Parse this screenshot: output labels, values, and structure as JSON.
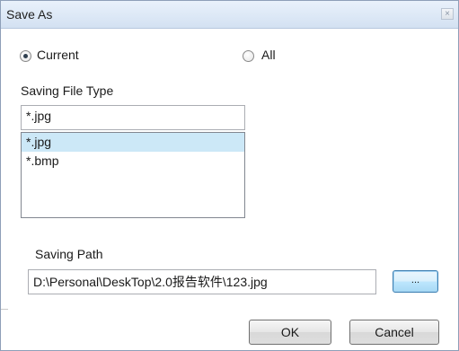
{
  "window": {
    "title": "Save As",
    "close_glyph": "×"
  },
  "scope": {
    "current_label": "Current",
    "all_label": "All",
    "selected": "Current"
  },
  "file_type": {
    "label": "Saving File Type",
    "value": "*.jpg",
    "options": [
      "*.jpg",
      "*.bmp"
    ],
    "selected_option": "*.jpg"
  },
  "path": {
    "label": "Saving Path",
    "value": "D:\\Personal\\DeskTop\\2.0报告软件\\123.jpg",
    "browse_label": "..."
  },
  "buttons": {
    "ok": "OK",
    "cancel": "Cancel"
  },
  "icons": {
    "close": "close-icon",
    "radio": "radio-icon"
  }
}
